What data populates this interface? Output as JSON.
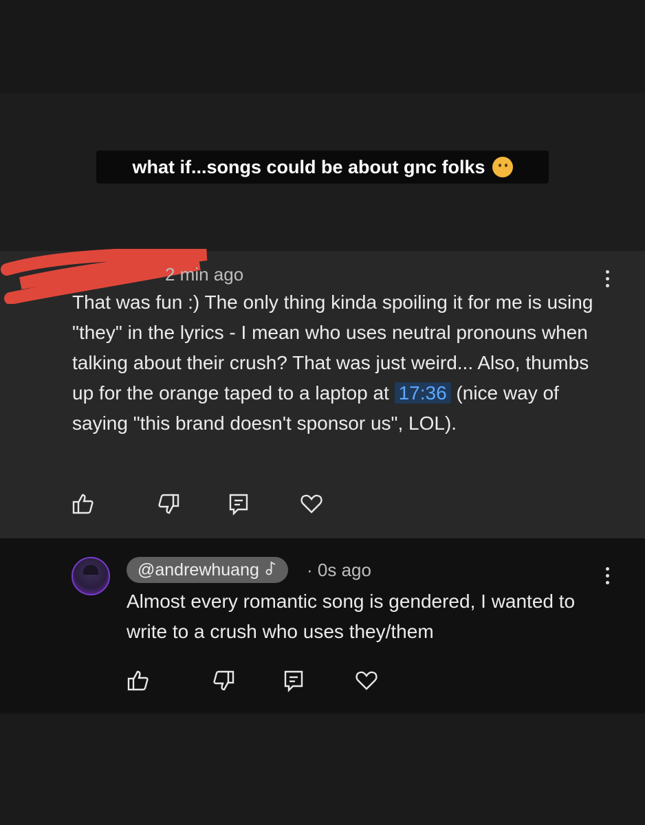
{
  "caption": {
    "text": "what if...songs could be about gnc folks",
    "emoji": "thinking-face"
  },
  "comment1": {
    "time": "2 min ago",
    "text_before_link": "That was fun :) The only thing kinda spoiling it for me is using \"they\" in the lyrics - I mean who uses neutral pronouns when talking about their crush? That was just weird... Also, thumbs up for the orange taped to a laptop at ",
    "timestamp_link": "17:36",
    "text_after_link": " (nice way of saying \"this brand doesn't sponsor us\", LOL).",
    "redaction_color": "#e0473b"
  },
  "comment2": {
    "handle": "@andrewhuang",
    "separator": "·",
    "time": "0s ago",
    "text": "Almost every romantic song is gendered, I wanted to write to a crush who uses they/them"
  },
  "actions": [
    "like",
    "dislike",
    "reply",
    "heart"
  ],
  "colors": {
    "link": "#5ea8ff",
    "link_bg": "#1f3a5a",
    "accent_avatar": "#7a3ad0"
  }
}
